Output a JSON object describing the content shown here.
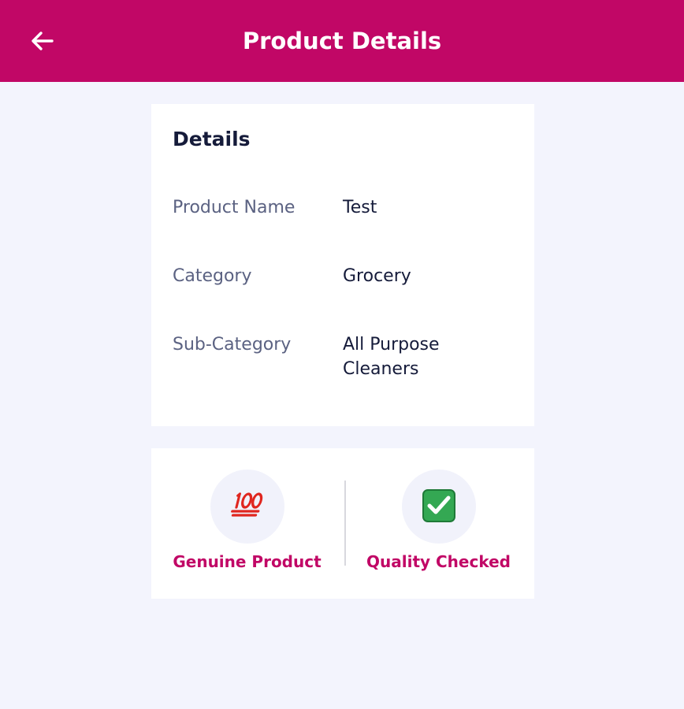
{
  "header": {
    "title": "Product Details",
    "background_color": "#c10766",
    "back_icon": "arrow-left-icon"
  },
  "details": {
    "title": "Details",
    "rows": [
      {
        "label": "Product Name",
        "value": "Test"
      },
      {
        "label": "Category",
        "value": "Grocery"
      },
      {
        "label": "Sub-Category",
        "value": "All Purpose Cleaners"
      }
    ]
  },
  "badges": [
    {
      "label": "Genuine Product",
      "icon": "hundred-points-icon",
      "color": "#c10766"
    },
    {
      "label": "Quality Checked",
      "icon": "check-mark-button-icon",
      "color": "#c10766"
    }
  ],
  "colors": {
    "accent": "#c10766",
    "page_background": "#f3f4fd",
    "text_dark": "#151b3a",
    "text_muted": "#5b6282",
    "check_green": "#34a853"
  }
}
